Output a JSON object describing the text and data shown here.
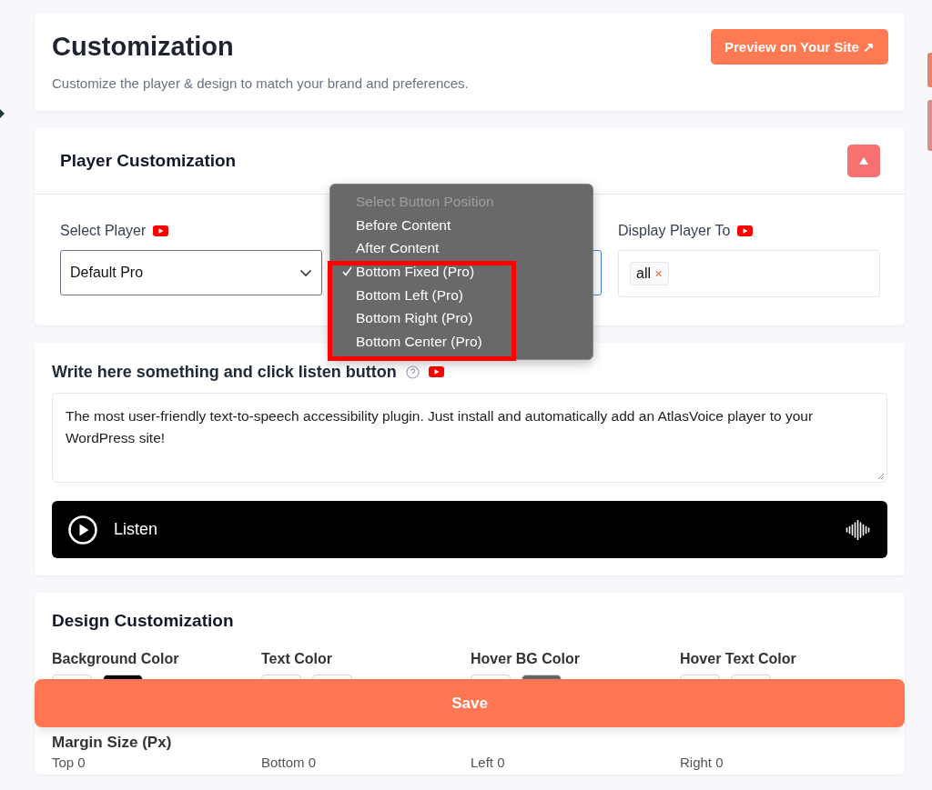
{
  "header": {
    "title": "Customization",
    "subtitle": "Customize the player & design to match your brand and preferences.",
    "preview_button": "Preview on Your Site ↗"
  },
  "player_customization": {
    "title": "Player Customization",
    "expanded": true,
    "select_player": {
      "label": "Select Player",
      "value": "Default Pro"
    },
    "display_player_to": {
      "label": "Display Player To",
      "tags": [
        {
          "label": "all",
          "remove": "×"
        }
      ]
    }
  },
  "position_menu": {
    "options": [
      {
        "label": "Select Button Position",
        "disabled": true,
        "selected": false,
        "highlighted": false
      },
      {
        "label": "Before Content",
        "disabled": false,
        "selected": false,
        "highlighted": false
      },
      {
        "label": "After Content",
        "disabled": false,
        "selected": false,
        "highlighted": false
      },
      {
        "label": "Bottom Fixed (Pro)",
        "disabled": false,
        "selected": true,
        "highlighted": true
      },
      {
        "label": "Bottom Left (Pro)",
        "disabled": false,
        "selected": false,
        "highlighted": true
      },
      {
        "label": "Bottom Right (Pro)",
        "disabled": false,
        "selected": false,
        "highlighted": true
      },
      {
        "label": "Bottom Center (Pro)",
        "disabled": false,
        "selected": false,
        "highlighted": true
      }
    ]
  },
  "speech": {
    "label": "Write here something and click listen button",
    "text": "The most user-friendly text-to-speech accessibility plugin. Just install and automatically add an AtlasVoice player to your WordPress site!",
    "player": {
      "label": "Listen"
    }
  },
  "design": {
    "title": "Design Customization",
    "colors": [
      {
        "label": "Background Color",
        "swatches": [
          {
            "color": "#ffffff"
          },
          {
            "color": "#000000"
          }
        ]
      },
      {
        "label": "Text Color",
        "swatches": [
          {
            "color": "#ffffff"
          },
          {
            "color": "#ffffff"
          }
        ]
      },
      {
        "label": "Hover BG Color",
        "swatches": [
          {
            "color": "#ffffff"
          },
          {
            "color": "#666666"
          }
        ]
      },
      {
        "label": "Hover Text Color",
        "swatches": [
          {
            "color": "#ffffff"
          },
          {
            "color": "#ffffff"
          }
        ]
      }
    ],
    "margin": {
      "title": "Margin Size (Px)",
      "fields": [
        "Top 0",
        "Bottom 0",
        "Left 0",
        "Right 0"
      ]
    }
  },
  "save_button": "Save"
}
